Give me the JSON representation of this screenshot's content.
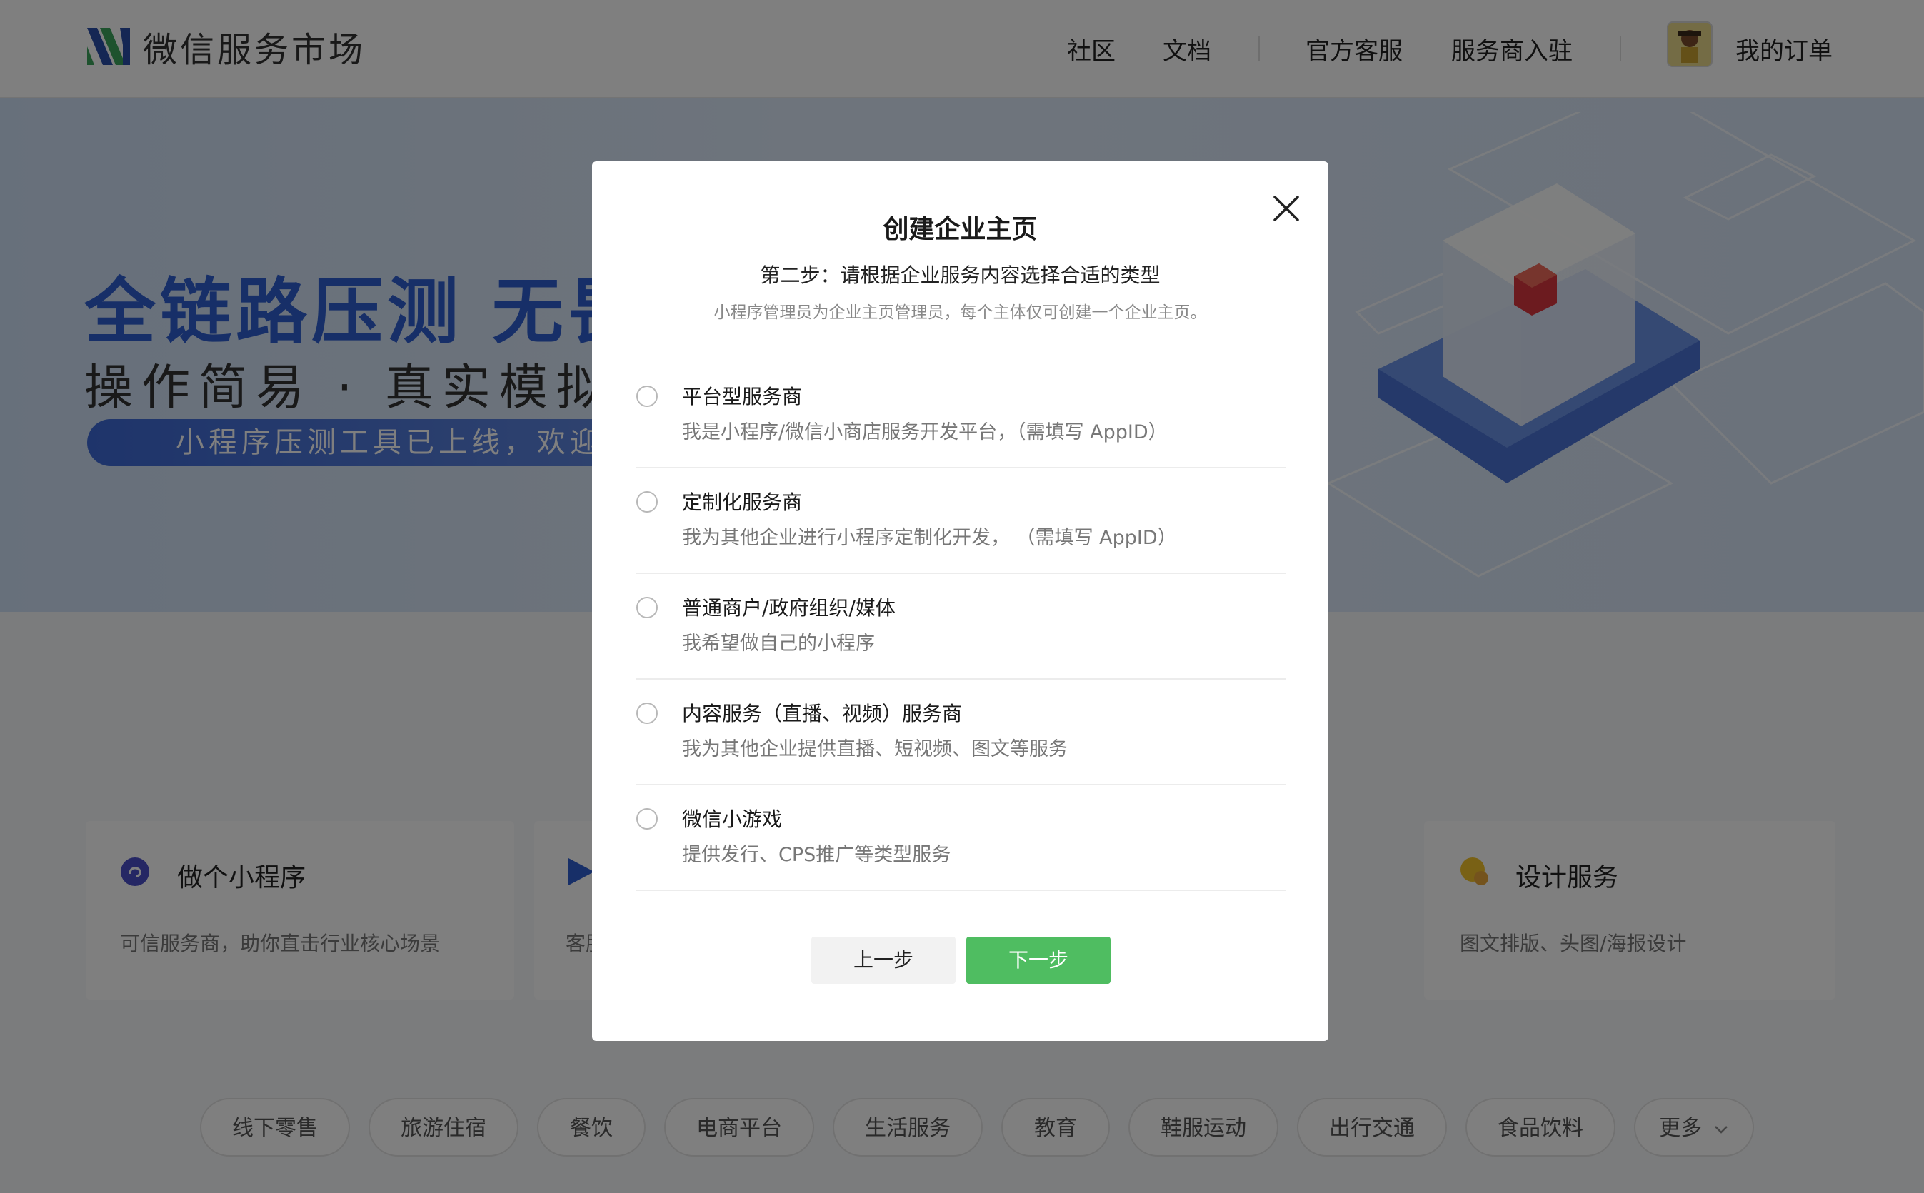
{
  "header": {
    "logo_text": "微信服务市场",
    "nav": {
      "community": "社区",
      "docs": "文档",
      "support": "官方客服",
      "provider_join": "服务商入驻",
      "my_orders": "我的订单"
    }
  },
  "banner": {
    "title": "全链路压测  无畏",
    "subtitle": "操作简易 · 真实模拟",
    "pill": "小程序压测工具已上线，欢迎"
  },
  "cards": [
    {
      "title": "做个小程序",
      "desc": "可信服务商，助你直击行业核心场景"
    },
    {
      "title": "",
      "desc": "客服"
    },
    {
      "title": "设计服务",
      "desc": "图文排版、头图/海报设计"
    }
  ],
  "categories": [
    "线下零售",
    "旅游住宿",
    "餐饮",
    "电商平台",
    "生活服务",
    "教育",
    "鞋服运动",
    "出行交通",
    "食品饮料",
    "更多"
  ],
  "modal": {
    "title": "创建企业主页",
    "step": "第二步：请根据企业服务内容选择合适的类型",
    "note": "小程序管理员为企业主页管理员，每个主体仅可创建一个企业主页。",
    "options": [
      {
        "title": "平台型服务商",
        "desc": "我是小程序/微信小商店服务开发平台，（需填写 AppID）"
      },
      {
        "title": "定制化服务商",
        "desc": "我为其他企业进行小程序定制化开发，  （需填写 AppID）"
      },
      {
        "title": "普通商户/政府组织/媒体",
        "desc": "我希望做自己的小程序"
      },
      {
        "title": "内容服务（直播、视频）服务商",
        "desc": "我为其他企业提供直播、短视频、图文等服务"
      },
      {
        "title": "微信小游戏",
        "desc": "提供发行、CPS推广等类型服务"
      }
    ],
    "prev_label": "上一步",
    "next_label": "下一步"
  },
  "colors": {
    "primary_green": "#4fbd61",
    "banner_blue": "#2f5fd0",
    "logo_green": "#3ca55c",
    "logo_blue": "#2b4fa8"
  }
}
